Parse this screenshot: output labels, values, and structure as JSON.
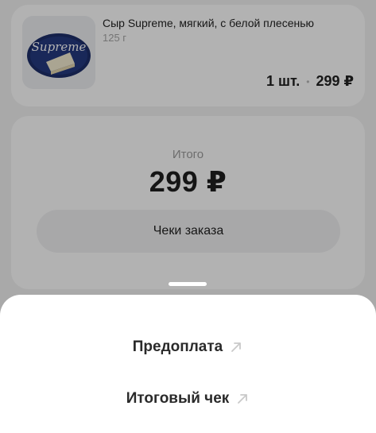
{
  "product": {
    "name": "Сыр Supreme, мягкий, с белой плесенью",
    "weight": "125 г",
    "quantity": "1 шт.",
    "separator": "•",
    "price": "299 ₽",
    "image_label": "Supreme"
  },
  "total": {
    "label": "Итого",
    "value": "299 ₽",
    "receipts_button_label": "Чеки заказа"
  },
  "sheet": {
    "items": [
      {
        "label": "Предоплата",
        "icon": "external-arrow-icon"
      },
      {
        "label": "Итоговый чек",
        "icon": "external-arrow-icon"
      }
    ]
  },
  "colors": {
    "overlay": "rgba(0,0,0,0.30)",
    "card_background": "#ffffff",
    "page_background": "#f2f2f3",
    "arrow_icon": "#c9c9c9"
  }
}
